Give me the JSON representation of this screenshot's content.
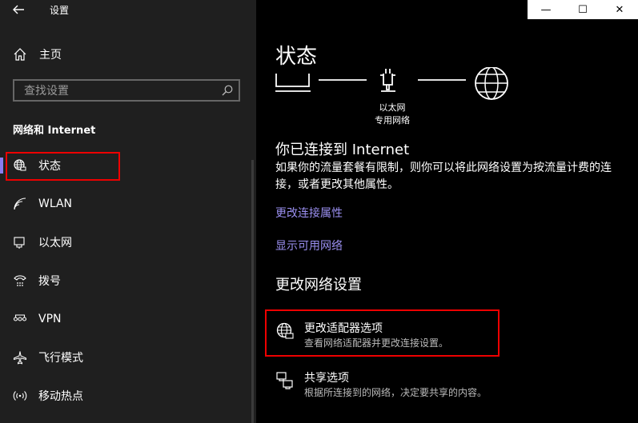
{
  "window": {
    "title": "设置"
  },
  "window_controls": {
    "minimize": "—",
    "maximize": "☐",
    "close": "✕"
  },
  "sidebar": {
    "home_label": "主页",
    "search_placeholder": "查找设置",
    "section_title": "网络和 Internet",
    "items": [
      {
        "label": "状态",
        "icon": "globe-network-icon",
        "active": true
      },
      {
        "label": "WLAN",
        "icon": "wifi-icon",
        "active": false
      },
      {
        "label": "以太网",
        "icon": "ethernet-icon",
        "active": false
      },
      {
        "label": "拨号",
        "icon": "dialup-icon",
        "active": false
      },
      {
        "label": "VPN",
        "icon": "vpn-icon",
        "active": false
      },
      {
        "label": "飞行模式",
        "icon": "airplane-icon",
        "active": false
      },
      {
        "label": "移动热点",
        "icon": "hotspot-icon",
        "active": false
      }
    ]
  },
  "main": {
    "title": "状态",
    "diagram": {
      "adapter_name": "以太网",
      "network_type": "专用网络"
    },
    "connected_title": "你已连接到 Internet",
    "connected_desc": "如果你的流量套餐有限制，则你可以将此网络设置为按流量计费的连接，或者更改其他属性。",
    "links": [
      "更改连接属性",
      "显示可用网络"
    ],
    "change_settings_title": "更改网络设置",
    "options": [
      {
        "title": "更改适配器选项",
        "desc": "查看网络适配器并更改连接设置。",
        "icon": "adapter-globe-icon"
      },
      {
        "title": "共享选项",
        "desc": "根据所连接到的网络，决定要共享的内容。",
        "icon": "sharing-icon"
      }
    ]
  },
  "colors": {
    "accent": "#8a7cf0",
    "highlight": "#e00000",
    "link": "#9a8ff0"
  }
}
